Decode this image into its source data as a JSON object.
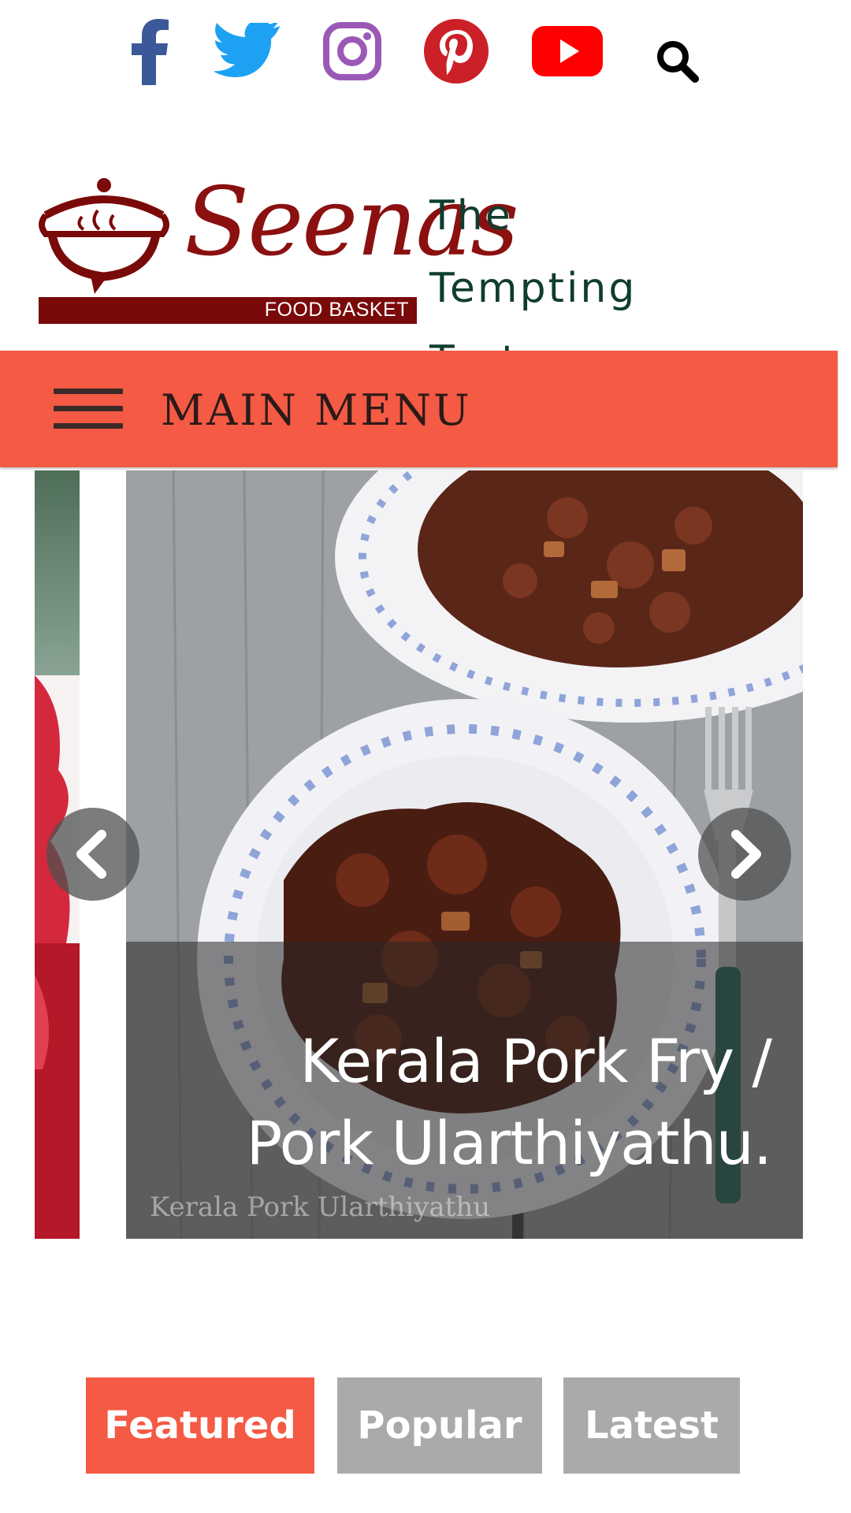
{
  "colors": {
    "accent": "#f45a44",
    "facebook": "#3b5998",
    "twitter": "#1da1f2",
    "instagram": "#9b59b6",
    "pinterest": "#cb2027",
    "youtube": "#ff0000",
    "logo_maroon": "#7a0a0a",
    "tagline": "#0f3d2e",
    "tab_inactive": "#aaaaaa"
  },
  "social": {
    "icons": [
      "facebook-icon",
      "twitter-icon",
      "instagram-icon",
      "pinterest-icon",
      "youtube-icon",
      "search-icon"
    ]
  },
  "header": {
    "logo": {
      "script_text": "Seenas",
      "band_text": "FOOD BASKET"
    },
    "tagline": "The Tempting Taste…"
  },
  "menu": {
    "icon": "hamburger-icon",
    "label": "MAIN MENU"
  },
  "slider": {
    "title": "Kerala Pork Fry / Pork Ularthiyathu.",
    "watermark": "Kerala Pork Ularthiyathu",
    "prev_icon": "chevron-left-icon",
    "next_icon": "chevron-right-icon"
  },
  "tabs": [
    {
      "label": "Featured",
      "active": true
    },
    {
      "label": "Popular",
      "active": false
    },
    {
      "label": "Latest",
      "active": false
    }
  ]
}
